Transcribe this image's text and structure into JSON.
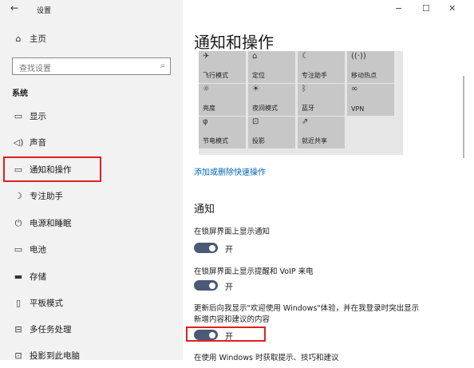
{
  "window": {
    "back_glyph": "←",
    "title": "设置",
    "minimize": "−",
    "maximize": "☐",
    "close": "✕"
  },
  "sidebar": {
    "home_label": "主页",
    "search_placeholder": "查找设置",
    "section": "系统",
    "items": [
      {
        "label": "显示",
        "icon": "monitor-icon"
      },
      {
        "label": "声音",
        "icon": "speaker-icon"
      },
      {
        "label": "通知和操作",
        "icon": "notification-icon",
        "selected": true
      },
      {
        "label": "专注助手",
        "icon": "moon-icon"
      },
      {
        "label": "电源和睡眠",
        "icon": "power-icon"
      },
      {
        "label": "电池",
        "icon": "battery-icon"
      },
      {
        "label": "存储",
        "icon": "storage-icon"
      },
      {
        "label": "平板模式",
        "icon": "tablet-icon"
      },
      {
        "label": "多任务处理",
        "icon": "multitask-icon"
      },
      {
        "label": "投影到此电脑",
        "icon": "project-icon"
      }
    ]
  },
  "main": {
    "page_title": "通知和操作",
    "quick_actions": [
      {
        "label": "飞行模式",
        "icon": "airplane-icon",
        "glyph": "✈"
      },
      {
        "label": "定位",
        "icon": "location-icon",
        "glyph": "⌂"
      },
      {
        "label": "专注助手",
        "icon": "moon-icon",
        "glyph": "☾"
      },
      {
        "label": "移动热点",
        "icon": "hotspot-icon",
        "glyph": "((·))"
      },
      {
        "label": "亮度",
        "icon": "brightness-icon",
        "glyph": "☼"
      },
      {
        "label": "夜间模式",
        "icon": "night-light-icon",
        "glyph": "☀"
      },
      {
        "label": "蓝牙",
        "icon": "bluetooth-icon",
        "glyph": "ᛒ"
      },
      {
        "label": "VPN",
        "icon": "vpn-icon",
        "glyph": "∞"
      },
      {
        "label": "节电模式",
        "icon": "battery-saver-icon",
        "glyph": "φ"
      },
      {
        "label": "投影",
        "icon": "project-icon",
        "glyph": "⊡"
      },
      {
        "label": "就近共享",
        "icon": "share-icon",
        "glyph": "⇗"
      }
    ],
    "edit_link": "添加或删除快速操作",
    "notifications_heading": "通知",
    "settings": [
      {
        "label": "在锁屏界面上显示通知",
        "state": "开"
      },
      {
        "label": "在锁屏界面上显示提醒和 VoIP 来电",
        "state": "开"
      },
      {
        "label_line1": "更新后向我显示\"欢迎使用 Windows\"体验，并在我登录时突出显示",
        "label_line2": "新增内容和建议的内容",
        "state": "开"
      }
    ],
    "cut_off_label": "在使用 Windows 时获取提示、技巧和建议"
  }
}
